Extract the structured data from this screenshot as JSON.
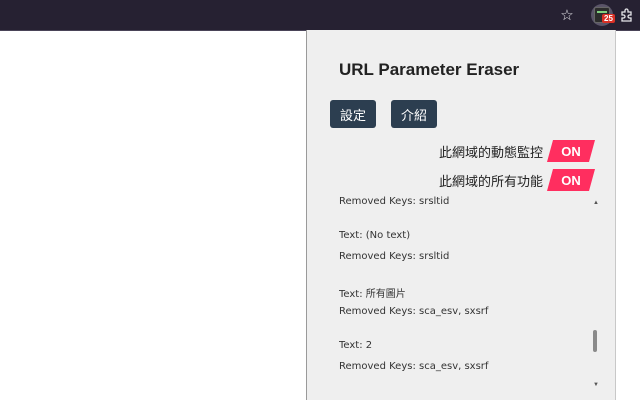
{
  "browser": {
    "star_icon": "star-icon",
    "extension_badge": "25",
    "extensions_icon": "puzzle-icon"
  },
  "popup": {
    "title": "URL Parameter Eraser",
    "buttons": {
      "settings": "設定",
      "about": "介紹"
    },
    "toggles": [
      {
        "label": "此網域的動態監控",
        "state": "ON"
      },
      {
        "label": "此網域的所有功能",
        "state": "ON"
      }
    ],
    "log": [
      "Removed Keys: srsltid",
      "Text: (No text)",
      "Removed Keys: srsltid",
      "Text: 所有圖片",
      "Removed Keys: sca_esv, sxsrf",
      "Text: 2",
      "Removed Keys: sca_esv, sxsrf"
    ]
  },
  "colors": {
    "toolbar": "#262132",
    "popup_bg": "#efefef",
    "button_bg": "#2c3e50",
    "toggle_on": "#ff2e5f"
  }
}
